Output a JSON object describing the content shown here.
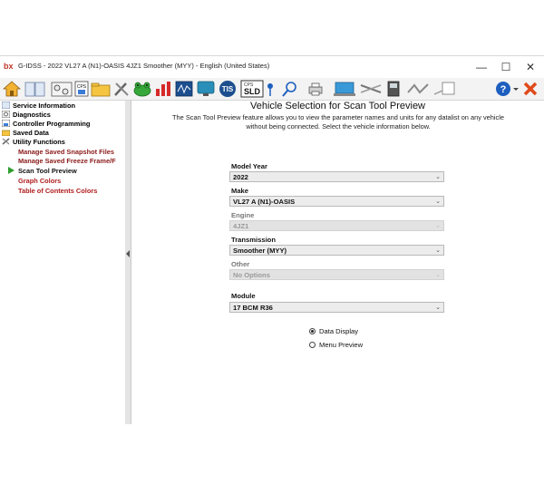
{
  "window": {
    "app_logo": "bx",
    "title": "G-IDSS - 2022 VL27 A (N1)-OASIS 4JZ1 Smoother (MYY) - English (United States)",
    "minimize": "—",
    "maximize": "☐",
    "close": "✕"
  },
  "toolbar": {
    "cps_label": "CPS",
    "tis_label": "TIS",
    "sld_top": "CPS",
    "sld_label": "SLD",
    "help_label": "?"
  },
  "sidebar": {
    "items": [
      {
        "label": "Service Information"
      },
      {
        "label": "Diagnostics"
      },
      {
        "label": "Controller Programming"
      },
      {
        "label": "Saved Data"
      },
      {
        "label": "Utility Functions"
      },
      {
        "label": "Manage Saved Snapshot Files"
      },
      {
        "label": "Manage Saved Freeze Frame/F"
      },
      {
        "label": "Scan Tool Preview"
      },
      {
        "label": "Graph Colors"
      },
      {
        "label": "Table of Contents Colors"
      }
    ]
  },
  "main": {
    "title": "Vehicle Selection for Scan Tool Preview",
    "description": "The Scan Tool Preview feature allows you to view the parameter names and units for any datalist on any vehicle without being connected.  Select the vehicle information below.",
    "fields": {
      "model_year": {
        "label": "Model Year",
        "value": "2022"
      },
      "make": {
        "label": "Make",
        "value": "VL27 A (N1)-OASIS"
      },
      "engine": {
        "label": "Engine",
        "value": "4JZ1"
      },
      "transmission": {
        "label": "Transmission",
        "value": "Smoother (MYY)"
      },
      "other": {
        "label": "Other",
        "value": "No Options"
      },
      "module": {
        "label": "Module",
        "value": "17 BCM R36"
      }
    },
    "radios": {
      "data_display": "Data Display",
      "menu_preview": "Menu Preview"
    },
    "selected_radio": "data_display"
  },
  "colors": {
    "submenu_text": "#8b1a1a",
    "active_arrow": "#2e9e2e",
    "close_icon": "#e04a1a",
    "help_icon": "#1d5fbf"
  }
}
